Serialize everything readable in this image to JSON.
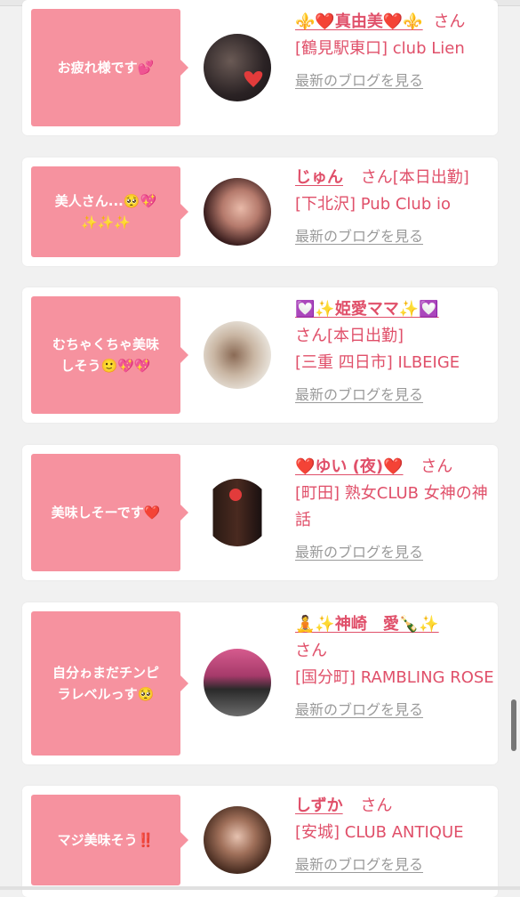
{
  "items": [
    {
      "comment": "お疲れ様です💕",
      "name": "⚜️❤️真由美❤️⚜️",
      "honorific": "さん",
      "shop": "[鶴見駅東口] club Lien",
      "blog_link": "最新のブログを見る"
    },
    {
      "comment": "美人さん...🥺💖\n✨✨✨",
      "name": "じゅん",
      "honorific": "さん[本日出勤]",
      "shop": "[下北沢] Pub Club io",
      "blog_link": "最新のブログを見る"
    },
    {
      "comment": "むちゃくちゃ美味\nしそう🙂💖💖",
      "name": "💟✨姫愛ママ✨💟",
      "honorific": "さん[本日出勤]",
      "shop": "[三重 四日市] ILBEIGE",
      "blog_link": "最新のブログを見る"
    },
    {
      "comment": "美味しそーです❤️",
      "name": "❤️ゆい (夜)❤️",
      "honorific": "さん",
      "shop": "[町田] 熟女CLUB 女神の神話",
      "blog_link": "最新のブログを見る"
    },
    {
      "comment": "自分ゎまだチンピ\nラレベルっす🥺",
      "name": "🧘✨神崎　愛🍾✨",
      "honorific": "さん",
      "shop": "[国分町] RAMBLING ROSE",
      "blog_link": "最新のブログを見る"
    },
    {
      "comment": "マジ美味そう‼️",
      "name": "しずか",
      "honorific": "さん",
      "shop": "[安城] CLUB ANTIQUE",
      "blog_link": "最新のブログを見る"
    }
  ],
  "colors": {
    "bubble": "#f6929f",
    "name_text": "#e0506a",
    "link_text": "#9a9a9a",
    "background": "#f1f1f1"
  }
}
